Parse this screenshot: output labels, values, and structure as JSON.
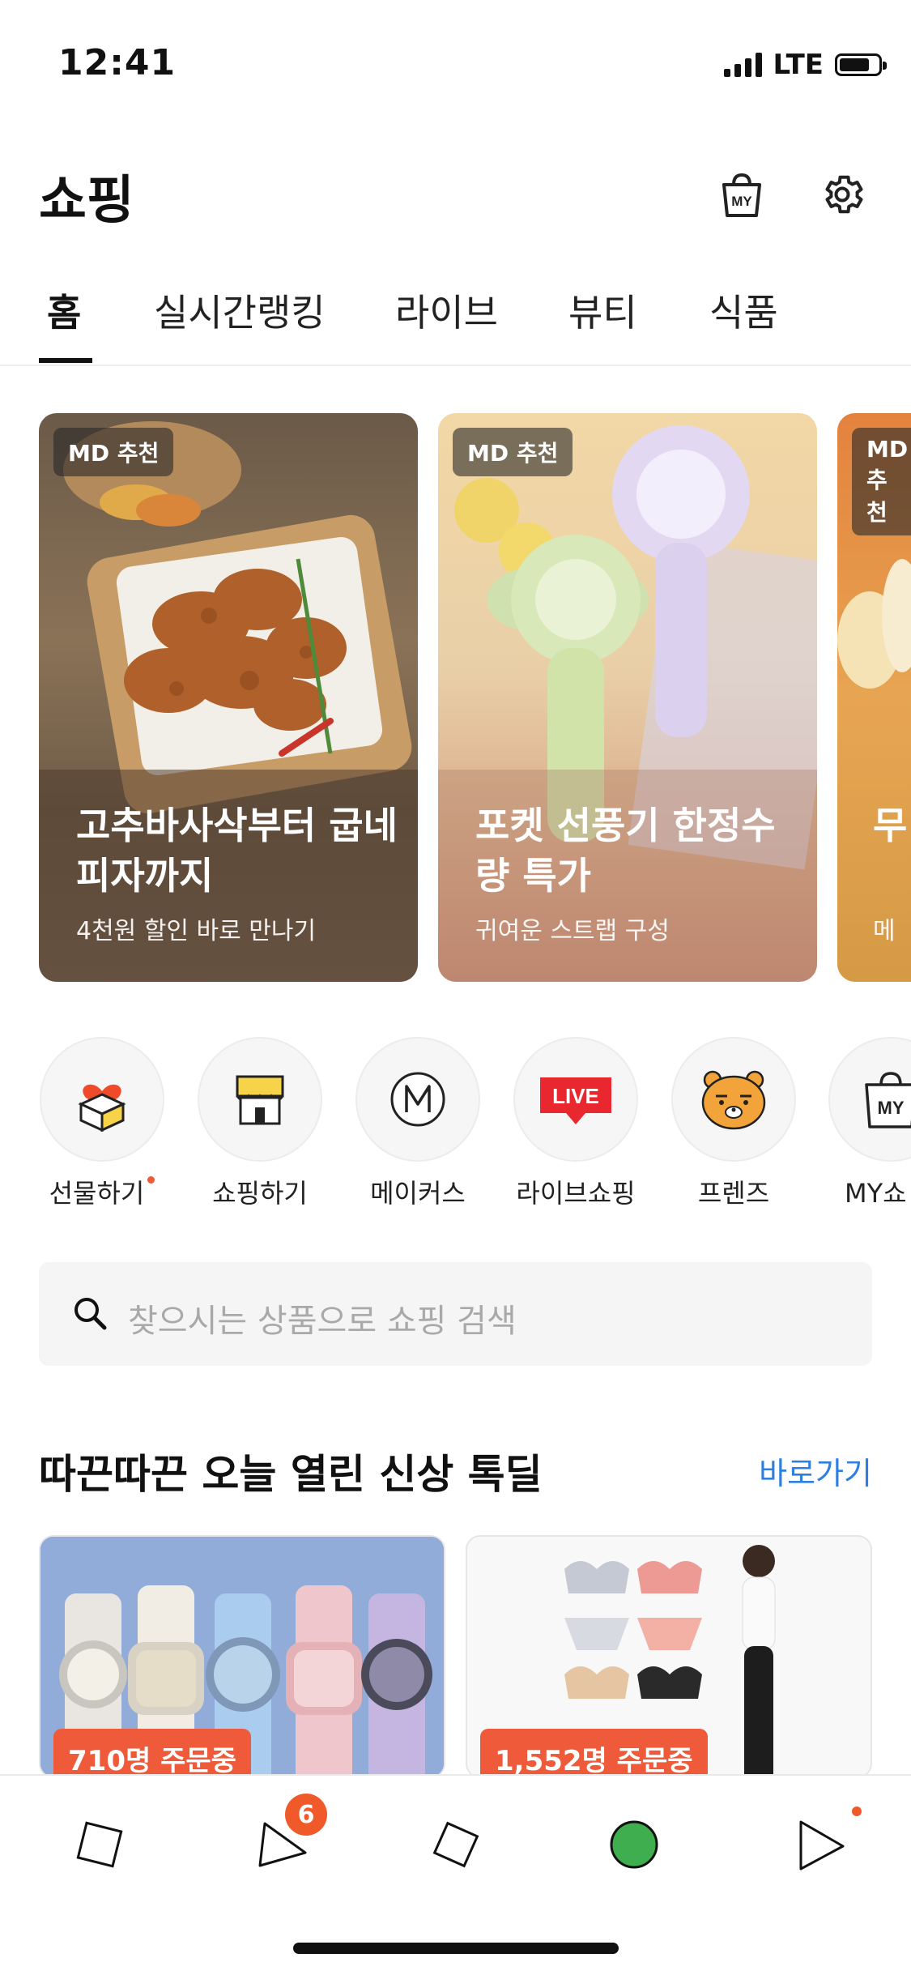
{
  "status": {
    "time": "12:41",
    "network": "LTE"
  },
  "header": {
    "title": "쇼핑",
    "my_icon_label": "MY"
  },
  "tabs": [
    {
      "label": "홈"
    },
    {
      "label": "실시간랭킹"
    },
    {
      "label": "라이브"
    },
    {
      "label": "뷰티"
    },
    {
      "label": "식품"
    }
  ],
  "cards": [
    {
      "badge": "MD 추천",
      "title": "고추바사삭부터 굽네피자까지",
      "subtitle": "4천원 할인 바로 만나기"
    },
    {
      "badge": "MD 추천",
      "title": "포켓 선풍기 한정수량 특가",
      "subtitle": "귀여운 스트랩 구성"
    },
    {
      "badge": "MD 추천",
      "title": "무",
      "subtitle": "메"
    }
  ],
  "categories": [
    {
      "label": "선물하기",
      "icon": "gift-icon"
    },
    {
      "label": "쇼핑하기",
      "icon": "store-icon"
    },
    {
      "label": "메이커스",
      "icon": "makers-icon"
    },
    {
      "label": "라이브쇼핑",
      "icon": "live-icon",
      "icon_text": "LIVE"
    },
    {
      "label": "프렌즈",
      "icon": "friends-icon"
    },
    {
      "label": "MY쇼",
      "icon": "my-bag-icon",
      "icon_text": "MY"
    }
  ],
  "search": {
    "placeholder": "찾으시는 상품으로 쇼핑 검색"
  },
  "section": {
    "title": "따끈따끈 오늘 열린 신상 톡딜",
    "link": "바로가기"
  },
  "products": [
    {
      "badge": "710명 주문중"
    },
    {
      "badge": "1,552명 주문중"
    }
  ],
  "bottom_nav": {
    "badge_count": "6"
  },
  "colors": {
    "accent": "#f05a2a",
    "link": "#2f7fe0",
    "live_red": "#e8282e"
  }
}
